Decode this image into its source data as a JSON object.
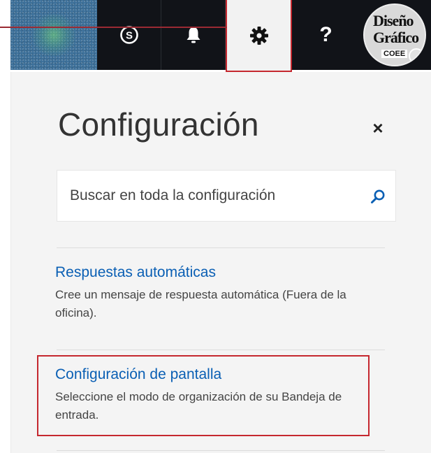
{
  "header": {
    "nav": [
      {
        "key": "skype",
        "icon": "skype-icon"
      },
      {
        "key": "notifications",
        "icon": "bell-icon"
      },
      {
        "key": "settings",
        "icon": "gear-icon"
      },
      {
        "key": "help",
        "icon": "question-mark-icon",
        "glyph": "?"
      }
    ],
    "avatar": {
      "line1": "Diseño",
      "line2": "Gráfico",
      "line3": "COEE"
    },
    "colors": {
      "bar": "#111318",
      "highlight": "#c5282f"
    }
  },
  "settings_panel": {
    "title": "Configuración",
    "close_glyph": "×",
    "search": {
      "placeholder": "Buscar en toda la configuración",
      "value": ""
    },
    "items": [
      {
        "title": "Respuestas automáticas",
        "description": "Cree un mensaje de respuesta automática (Fuera de la oficina)."
      },
      {
        "title": "Configuración de pantalla",
        "description": "Seleccione el modo de organización de su Bandeja de entrada."
      }
    ],
    "colors": {
      "link": "#0a5fb4",
      "background": "#f4f4f4"
    }
  }
}
